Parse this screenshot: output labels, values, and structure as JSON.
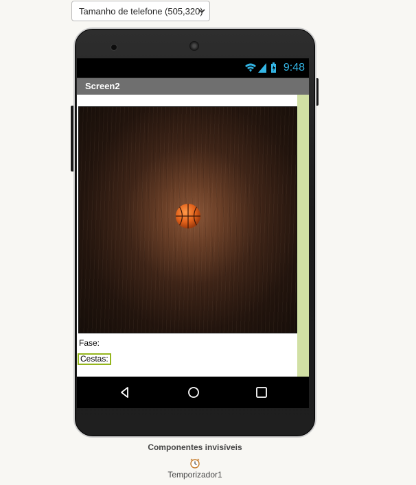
{
  "toolbar": {
    "size_select": {
      "selected": "Tamanho de telefone (505,320)",
      "icon": "chevron-down-icon"
    }
  },
  "phone": {
    "status_bar": {
      "time": "9:48",
      "icons": [
        "wifi-icon",
        "signal-icon",
        "battery-icon"
      ],
      "accent_color": "#33b5e5"
    },
    "screen_title": "Screen2",
    "canvas": {
      "sprite": "basketball-icon"
    },
    "labels": {
      "fase": "Fase:",
      "cestas": "Cestas:"
    },
    "selected_outline_color": "#94b51d",
    "nav_bar": {
      "buttons": [
        "back-icon",
        "home-icon",
        "recents-icon"
      ]
    }
  },
  "invisible_components": {
    "title": "Componentes invisíveis",
    "items": [
      {
        "label": "Temporizador1",
        "icon": "clock-icon"
      }
    ]
  }
}
